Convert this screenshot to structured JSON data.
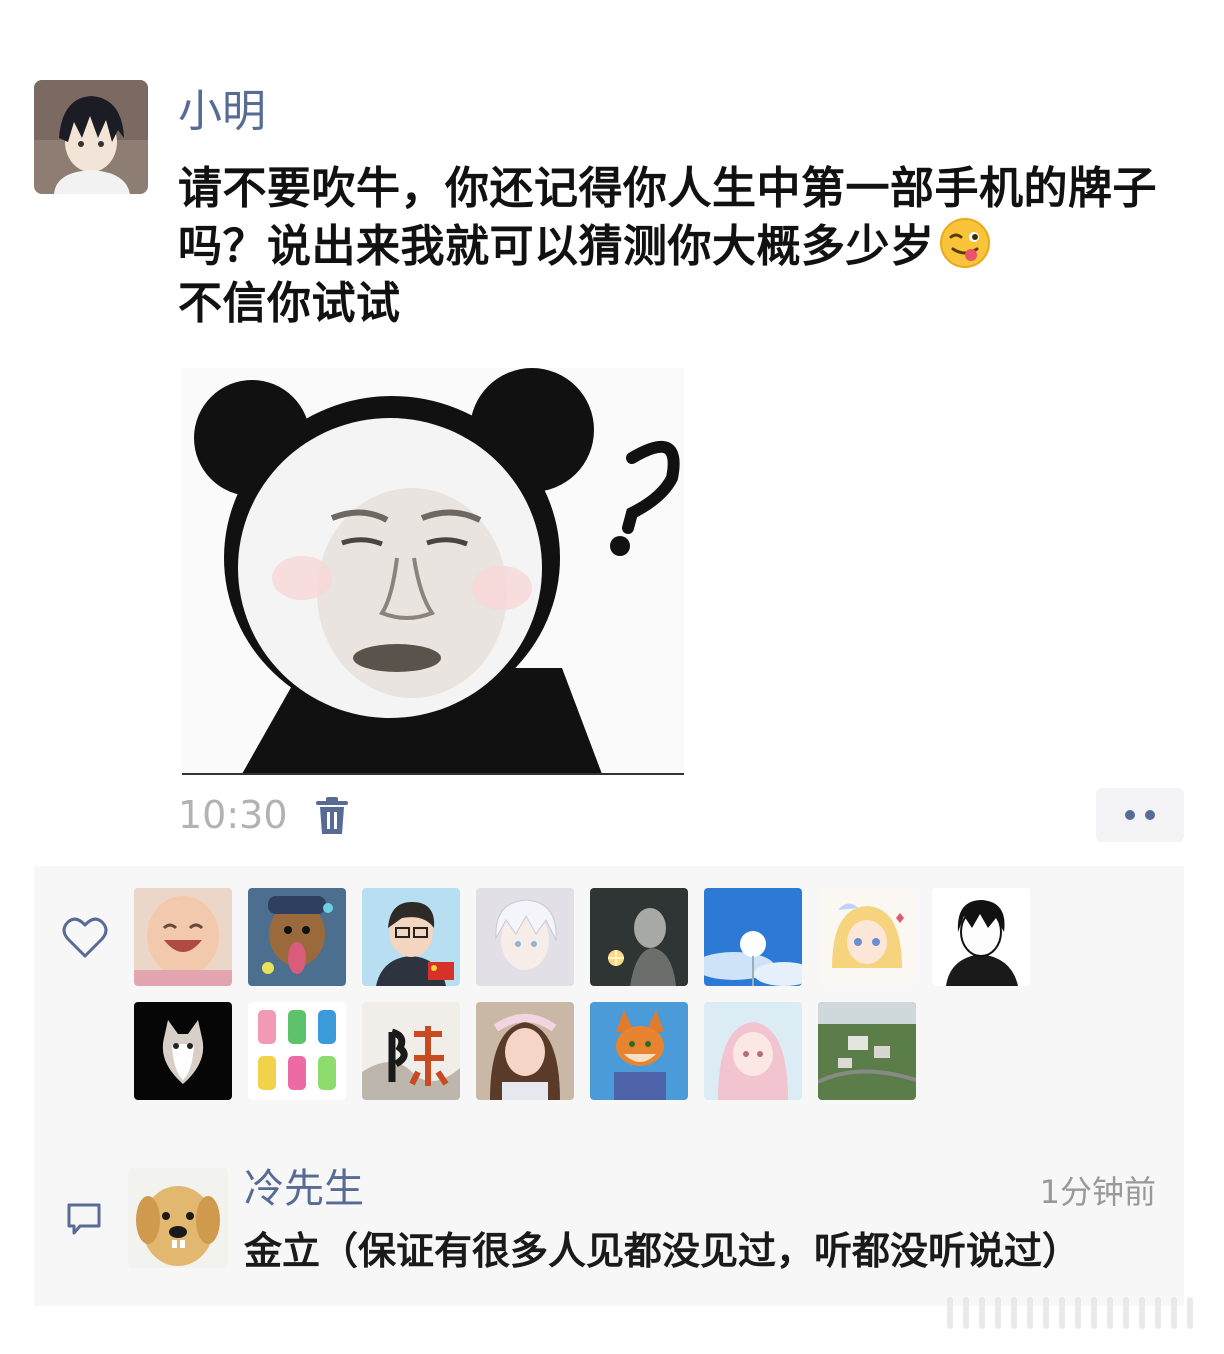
{
  "post": {
    "username": "小明",
    "text": "请不要吹牛，你还记得你人生中第一部手机的牌子吗？说出来我就可以猜测你大概多少岁",
    "text_tail": "不信你试试",
    "emoji": "wink-tongue-emoji",
    "time": "10:30"
  },
  "likes": {
    "count_avatars": 15,
    "avatars": [
      "baby-avatar",
      "dog-avatar",
      "cartoon-man-flag-avatar",
      "anime-white-hair-avatar",
      "dark-anime-avatar",
      "dandelion-sky-avatar",
      "anime-girl-blonde-avatar",
      "anime-boy-sketch-avatar",
      "cat-black-avatar",
      "colorful-figures-avatar",
      "calligraphy-chen-avatar",
      "girl-avatar",
      "zootopia-fox-avatar",
      "pink-anime-girl-avatar",
      "aerial-village-avatar"
    ]
  },
  "comment": {
    "username": "冷先生",
    "time": "1分钟前",
    "text": "金立（保证有很多人见都没见过，听都没听说过）"
  },
  "colors": {
    "link": "#576b95",
    "time": "#b2b2b2",
    "panel": "#f7f7f7"
  }
}
